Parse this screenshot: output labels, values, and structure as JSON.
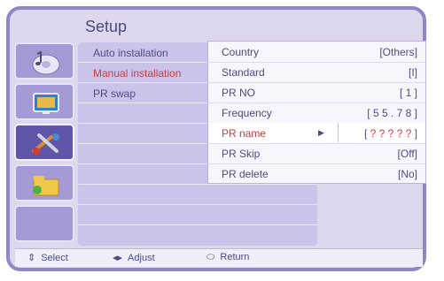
{
  "title": "Setup",
  "menu": {
    "items": [
      {
        "label": "Auto installation"
      },
      {
        "label": "Manual installation"
      },
      {
        "label": "PR swap"
      }
    ]
  },
  "submenu": {
    "rows": [
      {
        "label": "Country",
        "value": "[Others]"
      },
      {
        "label": "Standard",
        "value": "[I]"
      },
      {
        "label": "PR NO",
        "value": "[ 1 ]"
      },
      {
        "label": "Frequency",
        "value": "[ 5 5 . 7 8 ]"
      },
      {
        "label": "PR name",
        "value_prefix": "[ ",
        "value_q": "? ? ? ? ?",
        "value_suffix": " ]"
      },
      {
        "label": "PR Skip",
        "value": "[Off]"
      },
      {
        "label": "PR delete",
        "value": "[No]"
      }
    ]
  },
  "footer": {
    "select": "Select",
    "adjust": "Adjust",
    "return": "Return"
  },
  "icons": [
    "music-note-icon",
    "tv-screen-icon",
    "tools-icon",
    "folder-icon",
    "empty-slot"
  ],
  "colors": {
    "frame": "#8f86c6",
    "menu_bg": "#cbc4ea",
    "icon_bg": "#a49ad6",
    "icon_selected": "#5f56a9",
    "highlight_text": "#cf3b3b",
    "text": "#4f4a82"
  }
}
